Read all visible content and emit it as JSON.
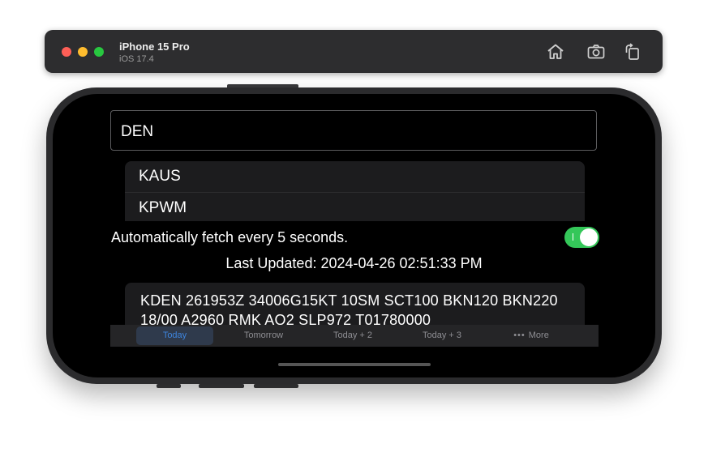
{
  "simulator": {
    "device": "iPhone 15 Pro",
    "os": "iOS 17.4",
    "buttons": [
      "home-icon",
      "screenshot-icon",
      "rotate-icon"
    ]
  },
  "app": {
    "search": {
      "value": "DEN"
    },
    "suggestions": [
      "KAUS",
      "KPWM"
    ],
    "auto_fetch": {
      "label": "Automatically fetch every 5 seconds.",
      "enabled": true,
      "toggle_mark": "I"
    },
    "last_updated": "Last Updated: 2024-04-26 02:51:33 PM",
    "metar": "KDEN 261953Z 34006G15KT 10SM SCT100 BKN120 BKN220 18/00 A2960 RMK AO2 SLP972 T01780000",
    "tabs": [
      {
        "label": "Today",
        "active": true
      },
      {
        "label": "Tomorrow"
      },
      {
        "label": "Today + 2"
      },
      {
        "label": "Today + 3"
      },
      {
        "label": "More",
        "icon": "•••"
      }
    ]
  },
  "colors": {
    "toggle_on": "#34c759",
    "tab_active": "#3e84dc",
    "screen_bg": "#000000"
  }
}
